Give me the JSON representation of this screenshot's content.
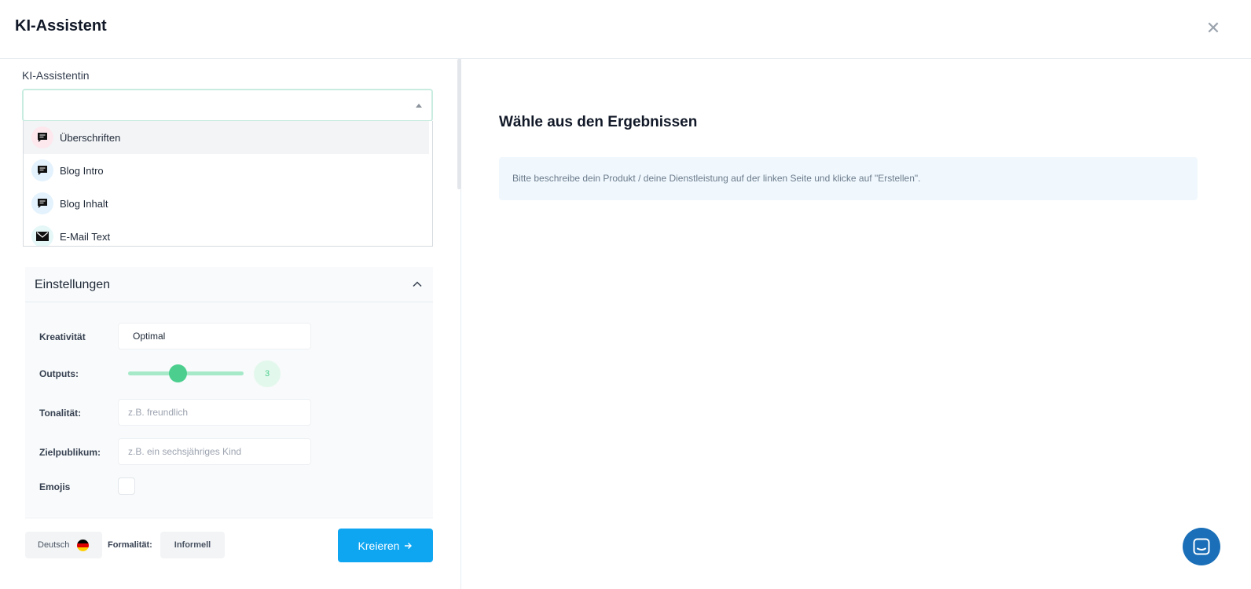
{
  "header": {
    "title": "KI-Assistent",
    "close_icon": "close-icon"
  },
  "assistant": {
    "label": "KI-Assistentin",
    "select_value": "",
    "options": [
      {
        "label": "Überschriften",
        "icon": "message-icon",
        "icon_bg": "#fde8ee"
      },
      {
        "label": "Blog Intro",
        "icon": "message-icon",
        "icon_bg": "#e3f2fd"
      },
      {
        "label": "Blog Inhalt",
        "icon": "message-icon",
        "icon_bg": "#e3f2fd"
      },
      {
        "label": "E-Mail Text",
        "icon": "mail-icon",
        "icon_bg": "#e6f7f7"
      }
    ]
  },
  "settings": {
    "title": "Einstellungen",
    "creativity": {
      "label": "Kreativität",
      "value": "Optimal"
    },
    "outputs": {
      "label": "Outputs:",
      "value": "3",
      "fraction": 0.44
    },
    "tone": {
      "label": "Tonalität:",
      "placeholder": "z.B. freundlich"
    },
    "audience": {
      "label": "Zielpublikum:",
      "placeholder": "z.B. ein sechsjähriges Kind"
    },
    "emojis": {
      "label": "Emojis",
      "checked": false
    }
  },
  "footer": {
    "language": "Deutsch",
    "flag_icon": "germany-flag-icon",
    "formality_label": "Formalität:",
    "formality_value": "Informell",
    "create_label": "Kreieren",
    "create_color": "#0ea5f1"
  },
  "results": {
    "title": "Wähle aus den Ergebnissen",
    "info": "Bitte beschreibe dein Produkt / deine Dienstleistung auf der linken Seite und klicke auf \"Erstellen\"."
  },
  "chat": {
    "icon": "chat-icon"
  }
}
